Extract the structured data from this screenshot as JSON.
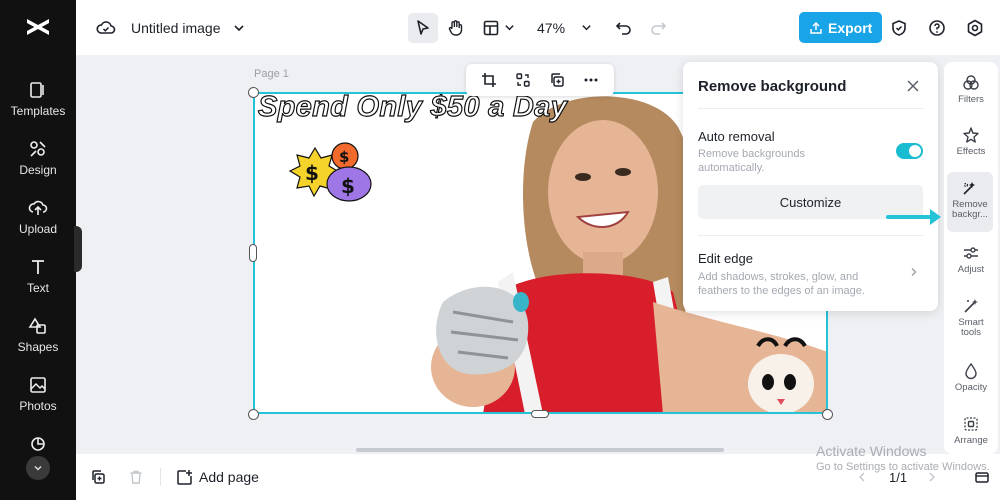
{
  "app": {
    "logo": "capcut-logo"
  },
  "sidebar": {
    "items": [
      {
        "label": "Templates",
        "icon": "templates-icon"
      },
      {
        "label": "Design",
        "icon": "design-icon"
      },
      {
        "label": "Upload",
        "icon": "upload-icon"
      },
      {
        "label": "Text",
        "icon": "text-icon"
      },
      {
        "label": "Shapes",
        "icon": "shapes-icon"
      },
      {
        "label": "Photos",
        "icon": "photos-icon"
      }
    ]
  },
  "header": {
    "doc_title": "Untitled image",
    "zoom": "47%",
    "export_label": "Export"
  },
  "canvas": {
    "page_label": "Page 1",
    "headline": "Spend Only $50 a Day"
  },
  "panel": {
    "title": "Remove background",
    "auto_removal": {
      "title": "Auto removal",
      "desc_1": "Remove backgrounds",
      "desc_2": "automatically.",
      "enabled": true
    },
    "customize_label": "Customize",
    "edit_edge": {
      "title": "Edit edge",
      "desc_1": "Add shadows, strokes, glow, and",
      "desc_2": "feathers to the edges of an image."
    }
  },
  "rightbar": {
    "items": [
      {
        "label_1": "Filters",
        "label_2": "",
        "icon": "filters-icon"
      },
      {
        "label_1": "Effects",
        "label_2": "",
        "icon": "effects-icon"
      },
      {
        "label_1": "Remove",
        "label_2": "backgr...",
        "icon": "remove-background-icon",
        "active": true
      },
      {
        "label_1": "Adjust",
        "label_2": "",
        "icon": "adjust-icon"
      },
      {
        "label_1": "Smart",
        "label_2": "tools",
        "icon": "smart-tools-icon"
      },
      {
        "label_1": "Opacity",
        "label_2": "",
        "icon": "opacity-icon"
      },
      {
        "label_1": "Arrange",
        "label_2": "",
        "icon": "arrange-icon"
      }
    ]
  },
  "footer": {
    "add_page_label": "Add page",
    "pager": "1/1"
  },
  "watermark": {
    "line1": "Activate Windows",
    "line2": "Go to Settings to activate Windows."
  },
  "colors": {
    "accent": "#24c3d7",
    "export": "#19a4e8",
    "sidebar_bg": "#111111"
  }
}
